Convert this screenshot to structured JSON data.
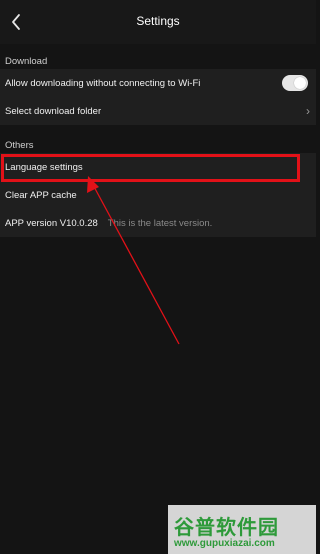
{
  "header": {
    "title": "Settings"
  },
  "sections": [
    {
      "label": "Download",
      "items": [
        {
          "label": "Allow downloading without connecting to Wi-Fi",
          "control": "toggle",
          "enabled": true
        },
        {
          "label": "Select download folder",
          "control": "chevron",
          "chevron": "›"
        }
      ]
    },
    {
      "label": "Others",
      "items": [
        {
          "label": "Language settings"
        },
        {
          "label": "Clear APP cache"
        },
        {
          "label": "APP version V10.0.28",
          "hint": "This is the latest version."
        }
      ]
    }
  ],
  "annotation": {
    "color": "#e21118"
  },
  "watermark": {
    "text": "谷普软件园",
    "url": "www.gupuxiazai.com"
  }
}
